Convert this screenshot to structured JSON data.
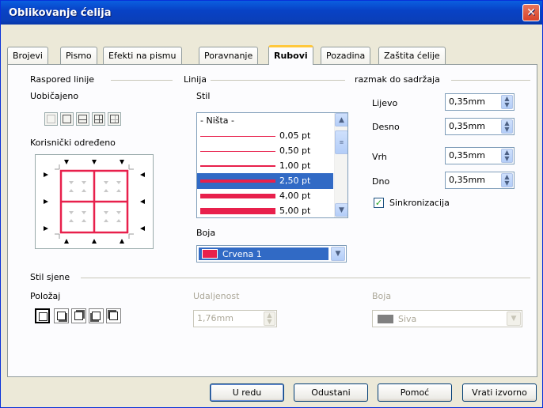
{
  "window": {
    "title": "Oblikovanje ćelija",
    "close": "✕"
  },
  "tabs": [
    "Brojevi",
    "Pismo",
    "Efekti na pismu",
    "Poravnanje",
    "Rubovi",
    "Pozadina",
    "Zaštita ćelije"
  ],
  "active_tab": "Rubovi",
  "line_arrangement": {
    "heading": "Raspored linije",
    "default_label": "Uobičajeno",
    "user_defined_label": "Korisnički određeno"
  },
  "line": {
    "heading": "Linija",
    "style_label": "Stil",
    "styles": [
      "- Ništa -",
      "0,05 pt",
      "0,50 pt",
      "1,00 pt",
      "2,50 pt",
      "4,00 pt",
      "5,00 pt"
    ],
    "selected_style": "2,50 pt",
    "color_label": "Boja",
    "color_value": "Crvena 1",
    "color_swatch": "#e8204c"
  },
  "spacing": {
    "heading": "razmak do sadržaja",
    "left_label": "Lijevo",
    "left_value": "0,35mm",
    "right_label": "Desno",
    "right_value": "0,35mm",
    "top_label": "Vrh",
    "top_value": "0,35mm",
    "bottom_label": "Dno",
    "bottom_value": "0,35mm",
    "sync_label": "Sinkronizacija",
    "sync_checked": true
  },
  "shadow": {
    "heading": "Stil sjene",
    "position_label": "Položaj",
    "distance_label": "Udaljenost",
    "distance_value": "1,76mm",
    "color_label": "Boja",
    "color_value": "Siva",
    "color_swatch": "#808080"
  },
  "buttons": {
    "ok": "U redu",
    "cancel": "Odustani",
    "help": "Pomoć",
    "reset": "Vrati izvorno"
  }
}
